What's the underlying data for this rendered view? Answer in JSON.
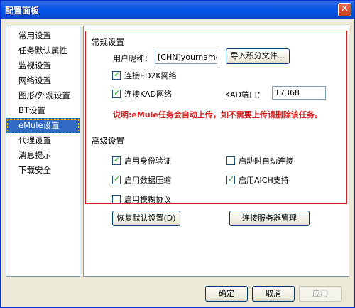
{
  "window": {
    "title": "配置面板",
    "close_glyph": "✕"
  },
  "nav": {
    "items": [
      {
        "label": "常用设置",
        "selected": false
      },
      {
        "label": "任务默认属性",
        "selected": false
      },
      {
        "label": "监视设置",
        "selected": false
      },
      {
        "label": "网络设置",
        "selected": false
      },
      {
        "label": "图形/外观设置",
        "selected": false
      },
      {
        "label": "BT设置",
        "selected": false
      },
      {
        "label": "eMule设置",
        "selected": true
      },
      {
        "label": "代理设置",
        "selected": false
      },
      {
        "label": "消息提示",
        "selected": false
      },
      {
        "label": "下载安全",
        "selected": false
      }
    ]
  },
  "general": {
    "title": "常规设置",
    "nickname_label": "用户昵称：",
    "nickname_value": "[CHN]yourname",
    "import_button": "导入积分文件...",
    "ed2k": {
      "label": "连接ED2K网络",
      "checked": true
    },
    "kad": {
      "label": "连接KAD网络",
      "checked": true
    },
    "kad_port_label": "KAD端口：",
    "kad_port_value": "17368",
    "note": "说明:eMule任务会自动上传，如不需要上传请删除该任务。"
  },
  "advanced": {
    "title": "高级设置",
    "auth": {
      "label": "启用身份验证",
      "checked": true
    },
    "autoconnect": {
      "label": "启动时自动连接",
      "checked": false
    },
    "compress": {
      "label": "启用数据压缩",
      "checked": true
    },
    "aich": {
      "label": "启用AICH支持",
      "checked": true
    },
    "fuzzy": {
      "label": "启用模糊协议",
      "checked": false
    }
  },
  "buttons": {
    "restore_defaults": "恢复默认设置(D)",
    "server_manager": "连接服务器管理",
    "ok": "确定",
    "cancel": "取消",
    "apply": "应用"
  },
  "icons": {
    "check": "check-icon",
    "close": "close-icon"
  },
  "colors": {
    "titlebar": "#0054e3",
    "selection": "#316ac5",
    "note": "#d21e1e",
    "frame": "#d42020"
  }
}
